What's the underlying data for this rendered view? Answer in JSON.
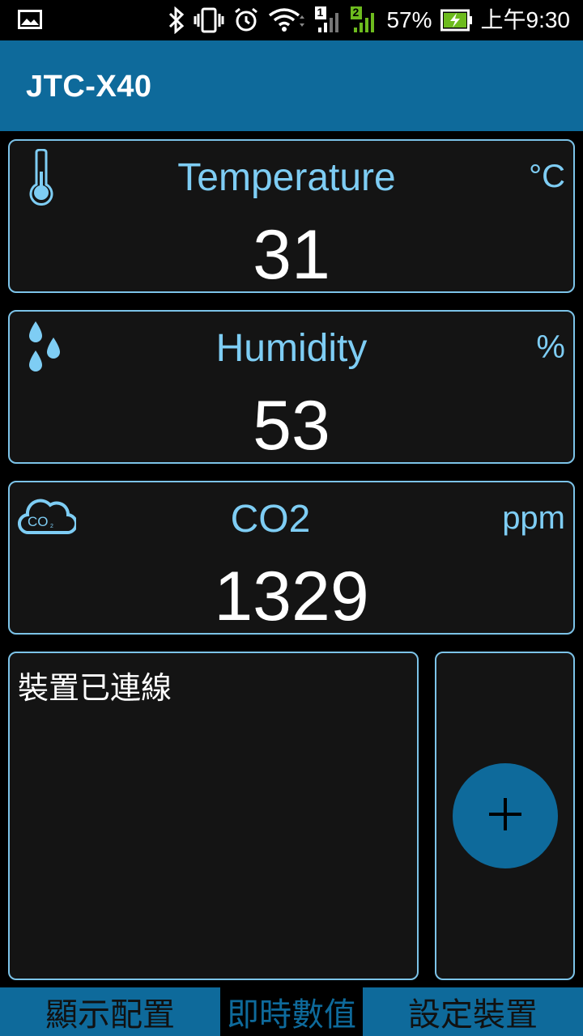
{
  "status_bar": {
    "battery_percent": "57%",
    "time": "上午9:30",
    "sim1_label": "1",
    "sim2_label": "2",
    "icons": [
      "image-icon",
      "bluetooth-icon",
      "vibrate-icon",
      "alarm-icon",
      "wifi-icon",
      "signal-sim1-icon",
      "signal-sim2-icon",
      "battery-charging-icon"
    ]
  },
  "app_bar": {
    "title": "JTC-X40"
  },
  "cards": {
    "temperature": {
      "label": "Temperature",
      "unit": "°C",
      "value": "31",
      "icon": "thermometer-icon"
    },
    "humidity": {
      "label": "Humidity",
      "unit": "%",
      "value": "53",
      "icon": "water-drops-icon"
    },
    "co2": {
      "label": "CO2",
      "unit": "ppm",
      "value": "1329",
      "icon": "co2-cloud-icon"
    }
  },
  "log": {
    "text": "裝置已連線"
  },
  "fab": {
    "label": "+",
    "icon": "plus-icon"
  },
  "tabs": [
    {
      "label": "顯示配置"
    },
    {
      "label": "即時數值"
    },
    {
      "label": "設定裝置"
    }
  ],
  "colors": {
    "accent": "#0e6a9b",
    "label_blue": "#7ecdf4",
    "card_border": "#7cc3e8",
    "card_bg": "#141414"
  }
}
